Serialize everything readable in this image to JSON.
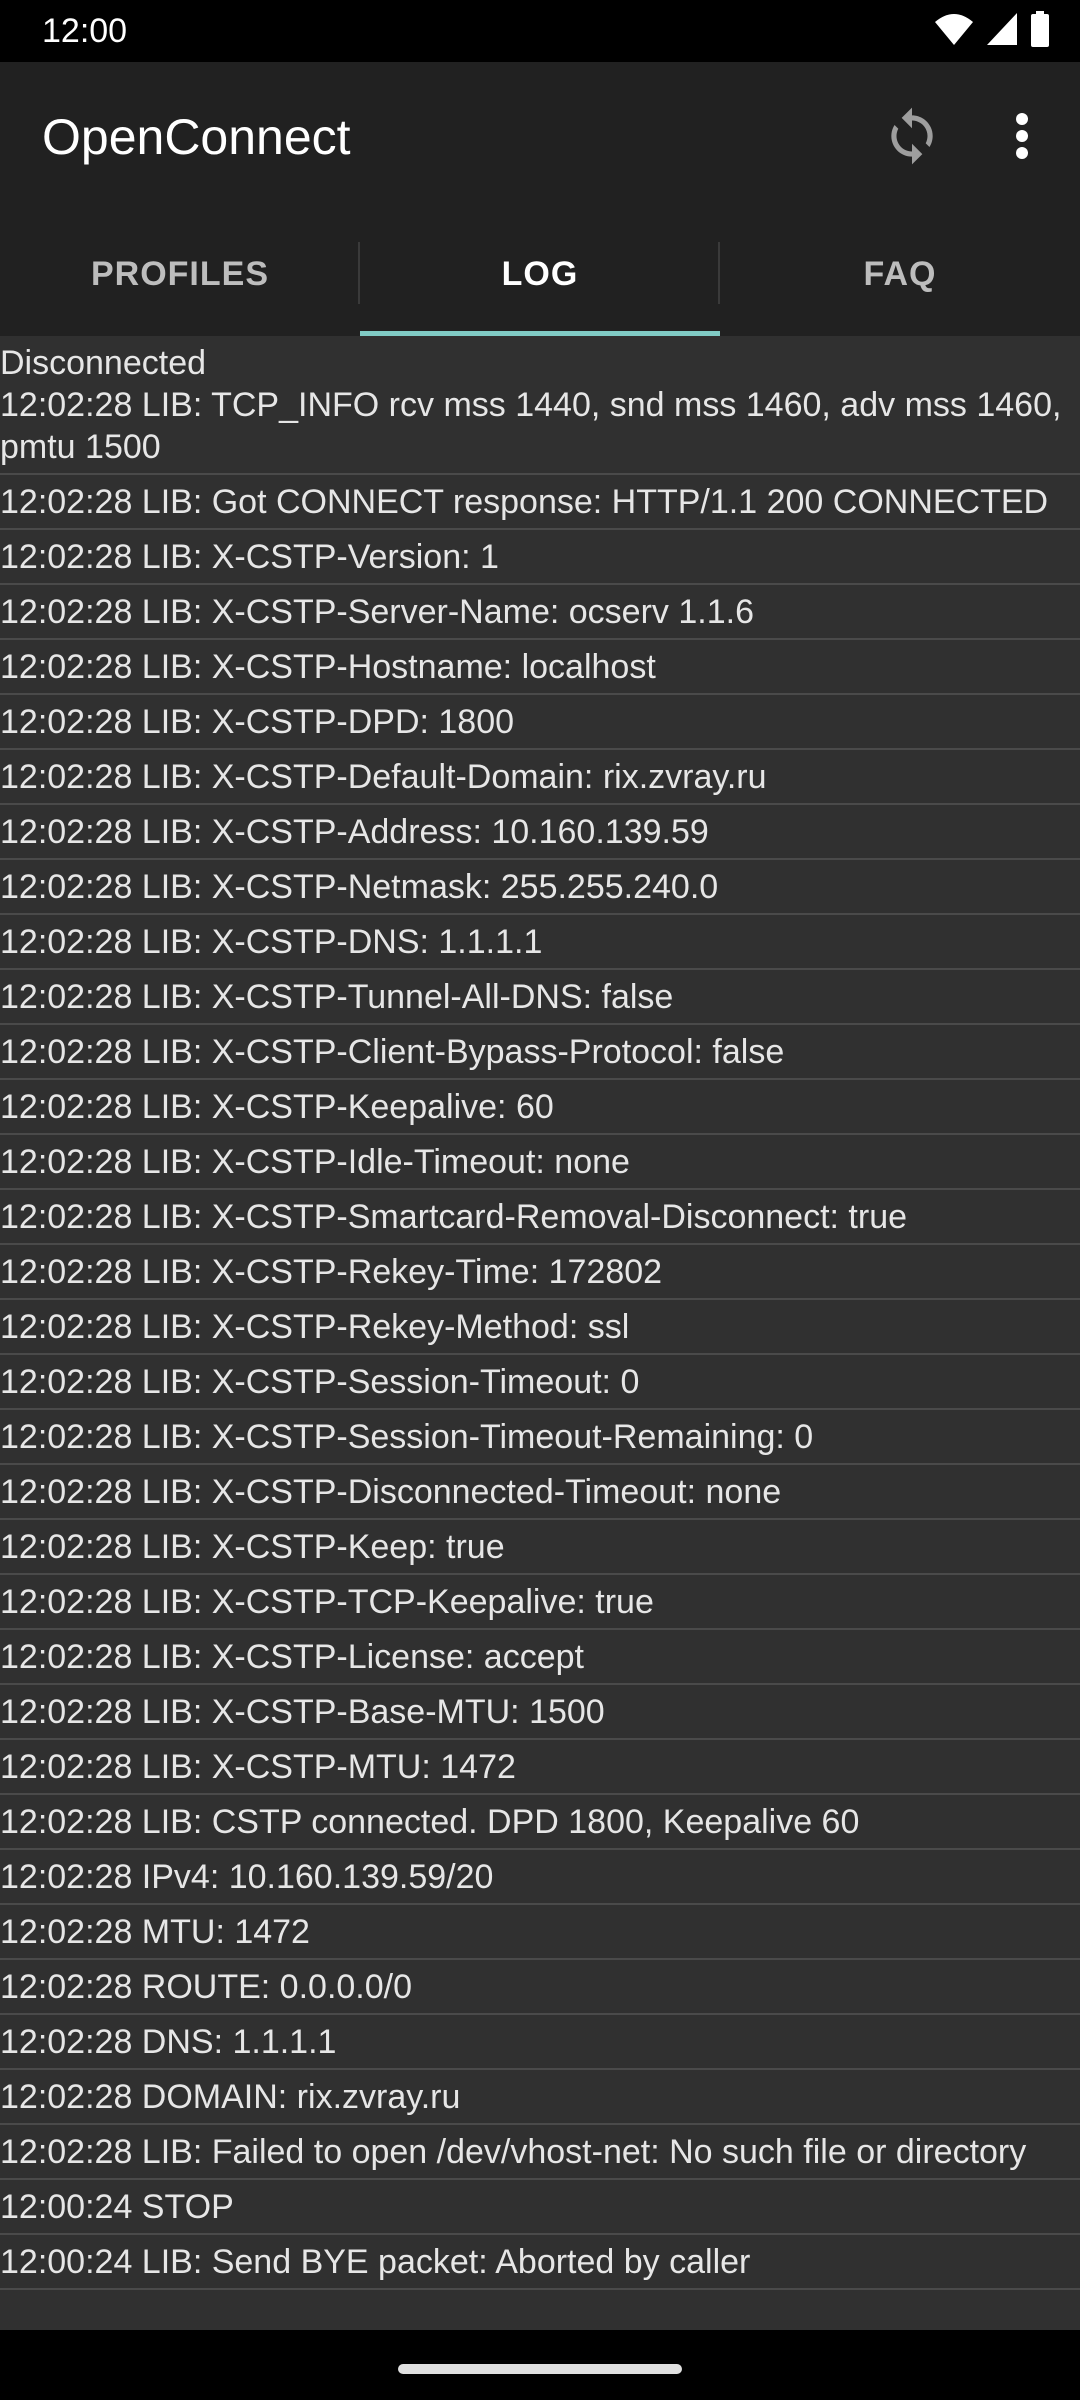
{
  "status_bar": {
    "time": "12:00",
    "icons": [
      "wifi-icon",
      "signal-icon",
      "battery-icon"
    ]
  },
  "app_bar": {
    "title": "OpenConnect",
    "actions": [
      "refresh-icon",
      "more-vert-icon"
    ]
  },
  "tabs": [
    {
      "label": "PROFILES",
      "active": false
    },
    {
      "label": "LOG",
      "active": true
    },
    {
      "label": "FAQ",
      "active": false
    }
  ],
  "colors": {
    "accent": "#80cbc4",
    "app_bar": "#212121",
    "background": "#303030"
  },
  "log": {
    "status": "Disconnected",
    "entries": [
      "12:02:28 LIB: TCP_INFO rcv mss 1440, snd mss 1460, adv mss 1460, pmtu 1500",
      "12:02:28 LIB: Got CONNECT response: HTTP/1.1 200 CONNECTED",
      "12:02:28 LIB: X-CSTP-Version: 1",
      "12:02:28 LIB: X-CSTP-Server-Name: ocserv 1.1.6",
      "12:02:28 LIB: X-CSTP-Hostname: localhost",
      "12:02:28 LIB: X-CSTP-DPD: 1800",
      "12:02:28 LIB: X-CSTP-Default-Domain: rix.zvray.ru",
      "12:02:28 LIB: X-CSTP-Address: 10.160.139.59",
      "12:02:28 LIB: X-CSTP-Netmask: 255.255.240.0",
      "12:02:28 LIB: X-CSTP-DNS: 1.1.1.1",
      "12:02:28 LIB: X-CSTP-Tunnel-All-DNS: false",
      "12:02:28 LIB: X-CSTP-Client-Bypass-Protocol: false",
      "12:02:28 LIB: X-CSTP-Keepalive: 60",
      "12:02:28 LIB: X-CSTP-Idle-Timeout: none",
      "12:02:28 LIB: X-CSTP-Smartcard-Removal-Disconnect: true",
      "12:02:28 LIB: X-CSTP-Rekey-Time: 172802",
      "12:02:28 LIB: X-CSTP-Rekey-Method: ssl",
      "12:02:28 LIB: X-CSTP-Session-Timeout: 0",
      "12:02:28 LIB: X-CSTP-Session-Timeout-Remaining: 0",
      "12:02:28 LIB: X-CSTP-Disconnected-Timeout: none",
      "12:02:28 LIB: X-CSTP-Keep: true",
      "12:02:28 LIB: X-CSTP-TCP-Keepalive: true",
      "12:02:28 LIB: X-CSTP-License: accept",
      "12:02:28 LIB: X-CSTP-Base-MTU: 1500",
      "12:02:28 LIB: X-CSTP-MTU: 1472",
      "12:02:28 LIB: CSTP connected. DPD 1800, Keepalive 60",
      "12:02:28 IPv4: 10.160.139.59/20",
      "12:02:28 MTU: 1472",
      "12:02:28 ROUTE: 0.0.0.0/0",
      "12:02:28 DNS: 1.1.1.1",
      "12:02:28 DOMAIN: rix.zvray.ru",
      "12:02:28 LIB: Failed to open /dev/vhost-net: No such file or directory",
      "12:00:24 STOP",
      "12:00:24 LIB: Send BYE packet: Aborted by caller"
    ]
  }
}
